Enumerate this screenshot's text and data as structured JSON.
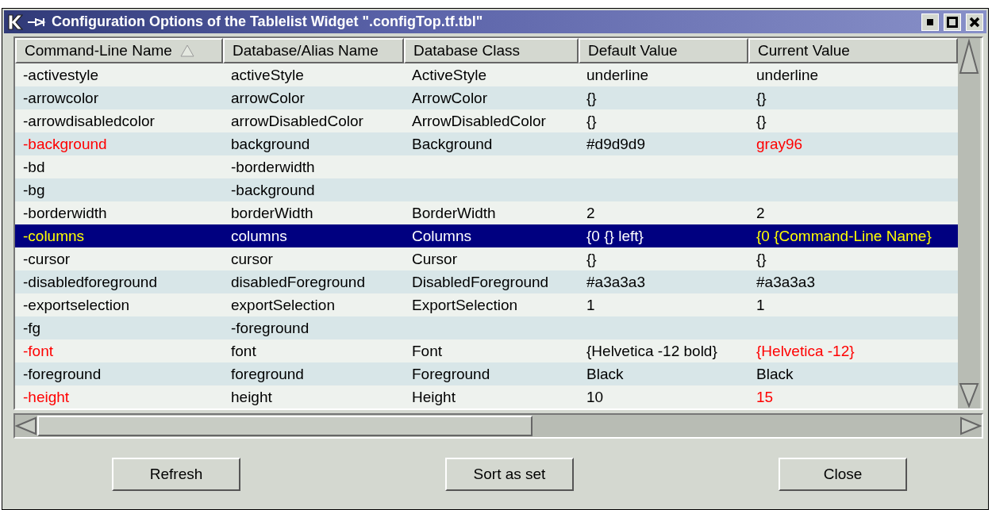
{
  "window": {
    "title": "Configuration Options of the Tablelist Widget \".configTop.tf.tbl\""
  },
  "table": {
    "columns": [
      {
        "label": "Command-Line Name",
        "sorted": true
      },
      {
        "label": "Database/Alias Name",
        "sorted": false
      },
      {
        "label": "Database Class",
        "sorted": false
      },
      {
        "label": "Default Value",
        "sorted": false
      },
      {
        "label": "Current Value",
        "sorted": false
      }
    ],
    "rows": [
      {
        "name": "-activestyle",
        "alias": "activeStyle",
        "class": "ActiveStyle",
        "default": "underline",
        "current": "underline",
        "modified": false,
        "selected": false
      },
      {
        "name": "-arrowcolor",
        "alias": "arrowColor",
        "class": "ArrowColor",
        "default": "{}",
        "current": "{}",
        "modified": false,
        "selected": false
      },
      {
        "name": "-arrowdisabledcolor",
        "alias": "arrowDisabledColor",
        "class": "ArrowDisabledColor",
        "default": "{}",
        "current": "{}",
        "modified": false,
        "selected": false
      },
      {
        "name": "-background",
        "alias": "background",
        "class": "Background",
        "default": "#d9d9d9",
        "current": "gray96",
        "modified": true,
        "selected": false
      },
      {
        "name": "-bd",
        "alias": "-borderwidth",
        "modified": false,
        "selected": false
      },
      {
        "name": "-bg",
        "alias": "-background",
        "modified": false,
        "selected": false
      },
      {
        "name": "-borderwidth",
        "alias": "borderWidth",
        "class": "BorderWidth",
        "default": "2",
        "current": "2",
        "modified": false,
        "selected": false
      },
      {
        "name": "-columns",
        "alias": "columns",
        "class": "Columns",
        "default": "{0 {} left}",
        "current": "{0 {Command-Line Name}",
        "modified": true,
        "selected": true
      },
      {
        "name": "-cursor",
        "alias": "cursor",
        "class": "Cursor",
        "default": "{}",
        "current": "{}",
        "modified": false,
        "selected": false
      },
      {
        "name": "-disabledforeground",
        "alias": "disabledForeground",
        "class": "DisabledForeground",
        "default": "#a3a3a3",
        "current": "#a3a3a3",
        "modified": false,
        "selected": false
      },
      {
        "name": "-exportselection",
        "alias": "exportSelection",
        "class": "ExportSelection",
        "default": "1",
        "current": "1",
        "modified": false,
        "selected": false
      },
      {
        "name": "-fg",
        "alias": "-foreground",
        "modified": false,
        "selected": false
      },
      {
        "name": "-font",
        "alias": "font",
        "class": "Font",
        "default": "{Helvetica -12 bold}",
        "current": "{Helvetica -12}",
        "modified": true,
        "selected": false
      },
      {
        "name": "-foreground",
        "alias": "foreground",
        "class": "Foreground",
        "default": "Black",
        "current": "Black",
        "modified": false,
        "selected": false
      },
      {
        "name": "-height",
        "alias": "height",
        "class": "Height",
        "default": "10",
        "current": "15",
        "modified": true,
        "selected": false
      }
    ]
  },
  "buttons": [
    {
      "label": "Refresh"
    },
    {
      "label": "Sort as set"
    },
    {
      "label": "Close"
    }
  ]
}
